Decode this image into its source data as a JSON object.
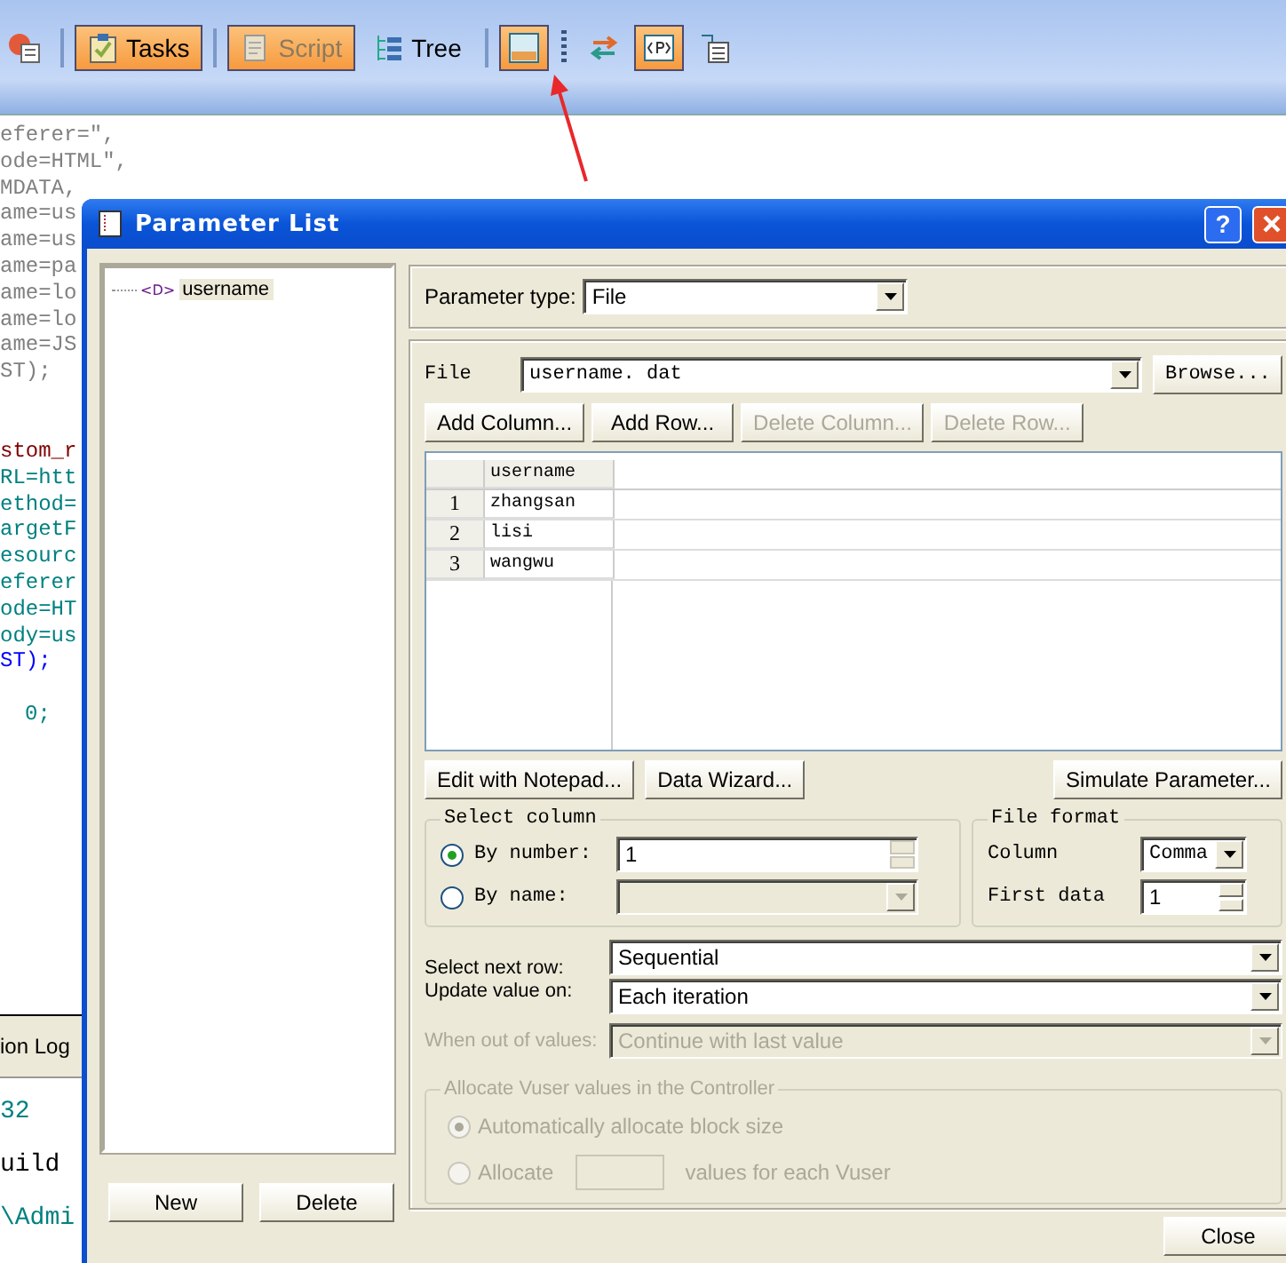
{
  "toolbar": {
    "items": [
      {
        "kind": "icon",
        "selected": false
      },
      {
        "kind": "separator"
      },
      {
        "kind": "text",
        "label": "Tasks",
        "selected": true,
        "disabled": false
      },
      {
        "kind": "separator"
      },
      {
        "kind": "text",
        "label": "Script",
        "selected": true,
        "disabled": true
      },
      {
        "kind": "text",
        "label": "Tree",
        "selected": false,
        "disabled": false
      },
      {
        "kind": "separator"
      },
      {
        "kind": "icon",
        "selected": true
      },
      {
        "kind": "grip"
      },
      {
        "kind": "icon",
        "selected": false
      },
      {
        "kind": "icon",
        "selected": true
      },
      {
        "kind": "icon",
        "selected": false
      }
    ]
  },
  "editor": {
    "blocks": [
      [
        {
          "text": "eferer=\",",
          "color": "#808080"
        },
        {
          "text": "ode=HTML\",",
          "color": "#808080"
        },
        {
          "text": "MDATA,",
          "color": "#808080"
        },
        {
          "text": "ame=us",
          "color": "#808080"
        },
        {
          "text": "ame=us",
          "color": "#808080"
        },
        {
          "text": "ame=pa",
          "color": "#808080"
        },
        {
          "text": "ame=lo",
          "color": "#808080"
        },
        {
          "text": "ame=lo",
          "color": "#808080"
        },
        {
          "text": "ame=JS",
          "color": "#808080"
        },
        {
          "text": "ST);",
          "color": "#808080"
        }
      ],
      [
        {
          "text": "stom_r",
          "color": "#800000"
        },
        {
          "text": "RL=htt",
          "color": "#008080"
        },
        {
          "text": "ethod=",
          "color": "#008080"
        },
        {
          "text": "argetF",
          "color": "#008080"
        },
        {
          "text": "esourc",
          "color": "#008080"
        },
        {
          "text": "eferer",
          "color": "#008080"
        },
        {
          "text": "ode=HT",
          "color": "#008080"
        },
        {
          "text": "ody=us",
          "color": "#008080"
        },
        {
          "text": "ST);",
          "color": "#0000ff"
        }
      ],
      [
        {
          "text": "0;",
          "color": "#008080"
        }
      ]
    ]
  },
  "output": {
    "tab": "ion Log",
    "lines": [
      {
        "text": "32",
        "color": "#008080"
      },
      {
        "text": "uild",
        "color": "#000000"
      },
      {
        "text": "\\Admi",
        "color": "#008080"
      }
    ]
  },
  "dialog": {
    "title": "Parameter List",
    "help": "?",
    "tree": [
      {
        "icon_label": "<D>",
        "label": "username",
        "selected": true
      }
    ],
    "new_button": "New",
    "delete_button": "Delete",
    "parameter_type": {
      "label": "Parameter type:",
      "value": "File"
    },
    "file": {
      "label": "File",
      "value": "username. dat",
      "browse": "Browse..."
    },
    "actions": [
      {
        "label": "Add Column...",
        "disabled": false
      },
      {
        "label": "Add Row...",
        "disabled": false
      },
      {
        "label": "Delete Column...",
        "disabled": true
      },
      {
        "label": "Delete Row...",
        "disabled": true
      }
    ],
    "table": {
      "columns": [
        "username"
      ],
      "rows": [
        {
          "number": "1",
          "cells": [
            "zhangsan"
          ]
        },
        {
          "number": "2",
          "cells": [
            "lisi"
          ]
        },
        {
          "number": "3",
          "cells": [
            "wangwu"
          ]
        }
      ]
    },
    "tools": [
      "Edit with Notepad...",
      "Data Wizard...",
      "Simulate Parameter..."
    ],
    "select_column": {
      "title": "Select column",
      "options": [
        {
          "kind": "spin",
          "label": "By number:",
          "value": "1",
          "selected": true
        },
        {
          "kind": "combo",
          "label": "By name:",
          "selected": false
        }
      ]
    },
    "file_format": {
      "title": "File format",
      "column_label": "Column",
      "column_value": "Comma",
      "first_data_label": "First data",
      "first_data_value": "1"
    },
    "select_next_row": {
      "label": "Select next row:",
      "value": "Sequential"
    },
    "update_value_on": {
      "label": "Update value on:",
      "value": "Each iteration"
    },
    "when_out": {
      "label": "When out of values:",
      "value": "Continue with last value",
      "disabled": true
    },
    "allocate": {
      "title": "Allocate Vuser values in the Controller",
      "disabled": true,
      "options": [
        {
          "label": "Automatically allocate block size",
          "selected": true
        },
        {
          "label": "Allocate",
          "suffix": "values for each Vuser",
          "selected": false
        }
      ]
    },
    "close": "Close"
  }
}
